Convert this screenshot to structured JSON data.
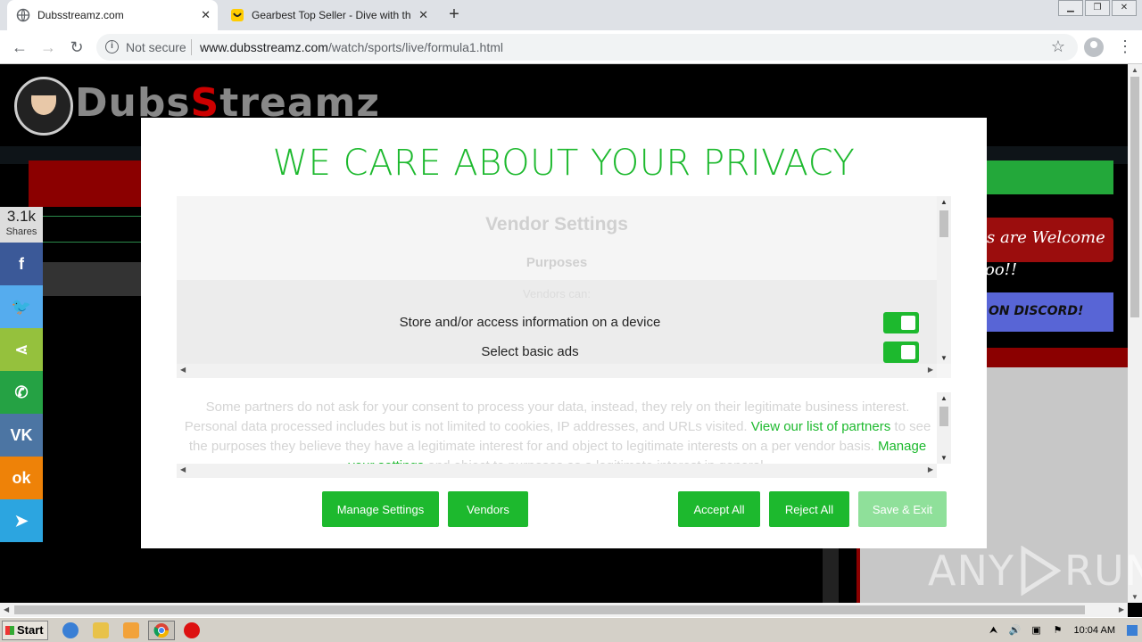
{
  "browser": {
    "tabs": [
      {
        "title": "Dubsstreamz.com",
        "active": true
      },
      {
        "title": "Gearbest Top Seller - Dive with the C",
        "active": false
      }
    ],
    "new_tab": "+",
    "security_label": "Not secure",
    "url_host": "www.dubsstreamz.com",
    "url_path": "/watch/sports/live/formula1.html"
  },
  "site": {
    "logo_prefix": "Dubs",
    "logo_s": "S",
    "logo_suffix": "treamz",
    "welcome_text": "s are Welcome",
    "too_text": "oo!!",
    "discord_text": "ON DISCORD!"
  },
  "share": {
    "count": "3.1k",
    "label": "Shares",
    "buttons": [
      {
        "icon": "facebook-icon",
        "glyph": "f",
        "color": "#3b5998"
      },
      {
        "icon": "twitter-icon",
        "glyph": "🐦",
        "color": "#55acee"
      },
      {
        "icon": "share-icon",
        "glyph": "⋖",
        "color": "#95c13d"
      },
      {
        "icon": "whatsapp-icon",
        "glyph": "✆",
        "color": "#25a244"
      },
      {
        "icon": "vk-icon",
        "glyph": "VK",
        "color": "#4c75a3"
      },
      {
        "icon": "odnoklassniki-icon",
        "glyph": "ok",
        "color": "#ee8208"
      },
      {
        "icon": "telegram-icon",
        "glyph": "➤",
        "color": "#2ca5e0"
      }
    ]
  },
  "privacy": {
    "title": "WE CARE ABOUT YOUR PRIVACY",
    "vendor_heading": "Vendor Settings",
    "purposes_heading": "Purposes",
    "vendors_can": "Vendors can:",
    "purposes": [
      {
        "label": "Store and/or access information on a device",
        "enabled": true
      },
      {
        "label": "Select basic ads",
        "enabled": true
      }
    ],
    "legit_text_1": "Some partners do not ask for your consent to process your data, instead, they rely on their legitimate business interest. Personal data processed includes but is not limited to cookies, IP addresses, and URLs visited.",
    "link_partners": "View our list of partners",
    "legit_text_2": "to see the purposes they believe they have a legitimate interest for and object to legitimate interests on a per vendor basis.",
    "link_manage": "Manage your settings",
    "legit_text_3": "and object to purposes as a legitimate interest in general.",
    "buttons": {
      "manage_settings": "Manage Settings",
      "vendors": "Vendors",
      "accept_all": "Accept All",
      "reject_all": "Reject All",
      "save_exit": "Save & Exit"
    },
    "accent_color": "#1db92e"
  },
  "watermark": {
    "left": "ANY",
    "right": "RUN"
  },
  "taskbar": {
    "start_label": "Start",
    "clock": "10:04 AM"
  }
}
